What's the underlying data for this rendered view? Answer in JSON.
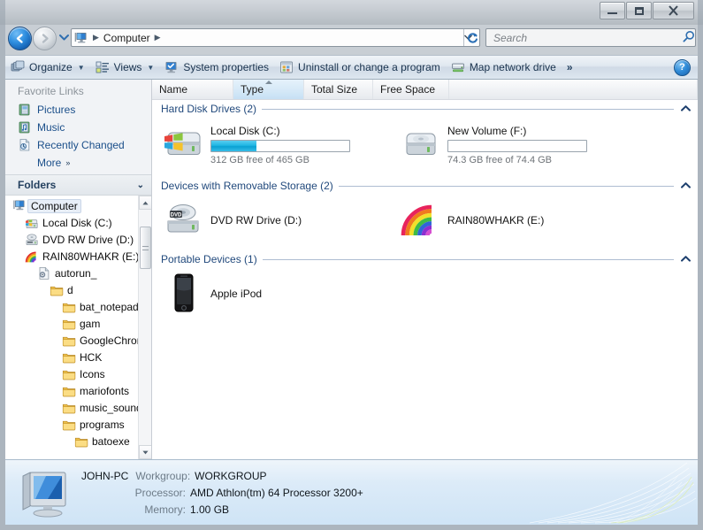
{
  "window": {
    "title": "",
    "controls": {
      "minimize": "–",
      "maximize": "❐",
      "close": "✕"
    }
  },
  "address": {
    "back_label": "◀",
    "forward_label": "▶",
    "history_caret": "▼",
    "crumb_icon": "computer-icon",
    "crumb_text": "Computer",
    "crumb_sep": "▶",
    "dropdown_caret": "▼",
    "refresh_label": "↻"
  },
  "search": {
    "placeholder": "Search",
    "icon": "magnifier-icon"
  },
  "toolbar": {
    "items": [
      {
        "label": "Organize",
        "icon": "organize-icon",
        "caret": "▼"
      },
      {
        "label": "Views",
        "icon": "views-icon",
        "caret": "▼"
      },
      {
        "label": "System properties",
        "icon": "system-properties-icon",
        "caret": ""
      },
      {
        "label": "Uninstall or change a program",
        "icon": "uninstall-icon",
        "caret": ""
      },
      {
        "label": "Map network drive",
        "icon": "map-network-drive-icon",
        "caret": ""
      }
    ],
    "overflow": "»",
    "help_label": "?"
  },
  "navpane": {
    "favorites_title": "Favorite Links",
    "favorites": [
      {
        "label": "Pictures",
        "icon": "pictures-icon"
      },
      {
        "label": "Music",
        "icon": "music-icon"
      },
      {
        "label": "Recently Changed",
        "icon": "recently-changed-icon"
      }
    ],
    "more_label": "More",
    "more_chevron": "»",
    "folders_label": "Folders",
    "folders_chevron": "⌄",
    "tree": [
      {
        "label": "Computer",
        "icon": "computer-icon",
        "indent": 0,
        "selected": true
      },
      {
        "label": "Local Disk (C:)",
        "icon": "system-drive-icon",
        "indent": 1,
        "selected": false
      },
      {
        "label": "DVD RW Drive (D:)",
        "icon": "dvd-drive-icon",
        "indent": 1,
        "selected": false
      },
      {
        "label": "RAIN80WHAKR (E:)",
        "icon": "rainbow-drive-icon",
        "indent": 1,
        "selected": false
      },
      {
        "label": "autorun_",
        "icon": "autorun-file-icon",
        "indent": 2,
        "selected": false
      },
      {
        "label": "d",
        "icon": "folder-icon",
        "indent": 3,
        "selected": false
      },
      {
        "label": "bat_notepad",
        "icon": "folder-icon",
        "indent": 4,
        "selected": false
      },
      {
        "label": "gam",
        "icon": "folder-icon",
        "indent": 4,
        "selected": false
      },
      {
        "label": "GoogleChrome",
        "icon": "folder-icon",
        "indent": 4,
        "selected": false
      },
      {
        "label": "HCK",
        "icon": "folder-icon",
        "indent": 4,
        "selected": false
      },
      {
        "label": "Icons",
        "icon": "folder-icon",
        "indent": 4,
        "selected": false
      },
      {
        "label": "mariofonts",
        "icon": "folder-icon",
        "indent": 4,
        "selected": false
      },
      {
        "label": "music_sounds",
        "icon": "folder-icon",
        "indent": 4,
        "selected": false
      },
      {
        "label": "programs",
        "icon": "folder-icon",
        "indent": 4,
        "selected": false
      },
      {
        "label": "batoexe",
        "icon": "folder-icon",
        "indent": 5,
        "selected": false
      }
    ],
    "scroll_up": "▲",
    "scroll_down": "▼"
  },
  "columns": [
    {
      "label": "Name",
      "width": 92,
      "sorted": false
    },
    {
      "label": "Type",
      "width": 80,
      "sorted": true
    },
    {
      "label": "Total Size",
      "width": 78,
      "sorted": false
    },
    {
      "label": "Free Space",
      "width": 86,
      "sorted": false
    }
  ],
  "groups": [
    {
      "title": "Hard Disk Drives (2)",
      "chevron": "︿",
      "items": [
        {
          "name": "Local Disk (C:)",
          "icon": "system-drive-icon",
          "has_bar": true,
          "fill_percent": 33,
          "sub": "312 GB free of 465 GB"
        },
        {
          "name": "New Volume (F:)",
          "icon": "hard-drive-icon",
          "has_bar": true,
          "fill_percent": 0,
          "sub": "74.3 GB free of 74.4 GB"
        }
      ]
    },
    {
      "title": "Devices with Removable Storage (2)",
      "chevron": "︿",
      "items": [
        {
          "name": "DVD RW Drive (D:)",
          "icon": "dvd-drive-icon",
          "has_bar": false,
          "fill_percent": 0,
          "sub": ""
        },
        {
          "name": "RAIN80WHAKR (E:)",
          "icon": "rainbow-drive-icon",
          "has_bar": false,
          "fill_percent": 0,
          "sub": ""
        }
      ]
    },
    {
      "title": "Portable Devices (1)",
      "chevron": "︿",
      "items": [
        {
          "name": "Apple iPod",
          "icon": "ipod-icon",
          "has_bar": false,
          "fill_percent": 0,
          "sub": ""
        }
      ]
    }
  ],
  "details": {
    "icon": "computer-large-icon",
    "computer_name": "JOHN-PC",
    "rows": [
      {
        "label": "Workgroup:",
        "value": "WORKGROUP"
      },
      {
        "label": "Processor:",
        "value": "AMD Athlon(tm) 64 Processor 3200+"
      },
      {
        "label": "Memory:",
        "value": "1.00 GB"
      }
    ]
  },
  "colors": {
    "accent": "#21497c",
    "link": "#1b4f8a",
    "bar_fill": "#1fb6e3",
    "group_line": "#aebdd1",
    "sorted_column": "#d4e8f7"
  }
}
